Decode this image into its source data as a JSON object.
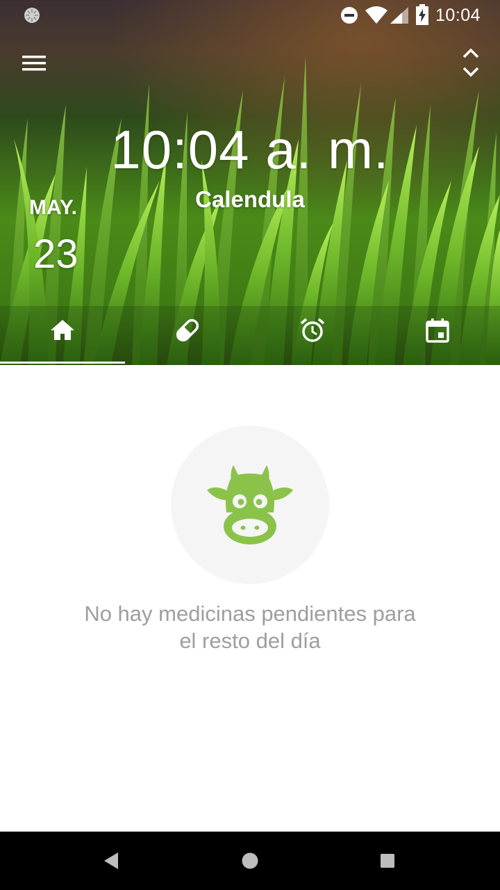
{
  "status_bar": {
    "time": "10:04",
    "icons": [
      "sync-icon",
      "do-not-disturb-icon",
      "wifi-icon",
      "signal-icon",
      "battery-charging-icon"
    ]
  },
  "toolbar": {
    "menu_icon": "hamburger-menu-icon",
    "expand_icon": "unfold-icon"
  },
  "header": {
    "time_display": "10:04 a. m.",
    "patient_name": "Calendula",
    "month": "MAY.",
    "day": "23"
  },
  "tabs": [
    {
      "icon": "home-icon",
      "selected": true
    },
    {
      "icon": "pill-icon",
      "selected": false
    },
    {
      "icon": "alarm-icon",
      "selected": false
    },
    {
      "icon": "calendar-icon",
      "selected": false
    }
  ],
  "empty_state": {
    "icon": "cow-icon",
    "line1": "No hay medicinas pendientes para",
    "line2": "el resto del día"
  },
  "colors": {
    "accent_green": "#8bc34a",
    "empty_text": "#9e9e9e",
    "circle_bg": "#f5f5f5"
  },
  "nav_bar": {
    "icons": [
      "back-icon",
      "home-circle-icon",
      "recents-icon"
    ]
  }
}
